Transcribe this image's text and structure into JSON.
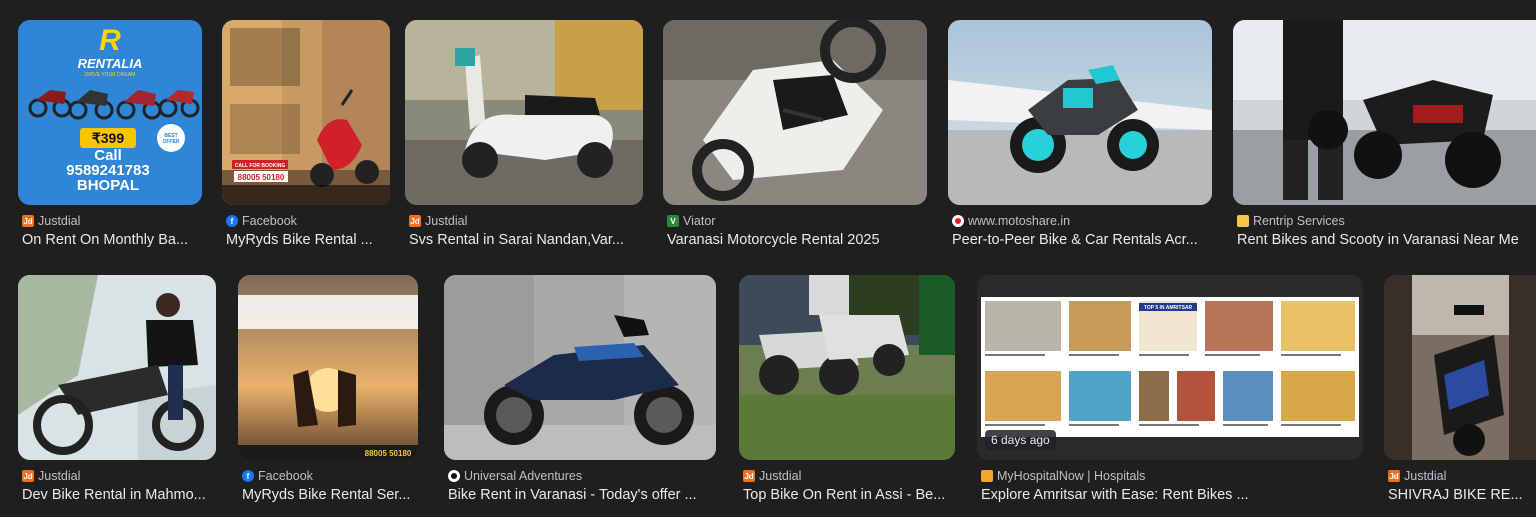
{
  "results": [
    {
      "source": "Justdial",
      "title": "On Rent On Monthly Ba...",
      "favicon": "justdial-icon",
      "overlay": {
        "brand": "RENTALIA",
        "tagline": "DRIVE YOUR DREAM",
        "price": "₹399",
        "offer": "BEST OFFER",
        "call": "Call",
        "phone": "9589241783",
        "city": "BHOPAL"
      }
    },
    {
      "source": "Facebook",
      "title": "MyRyds Bike Rental ...",
      "favicon": "facebook-icon",
      "overlay": {
        "cta": "CALL FOR BOOKING",
        "phone": "88005 50180"
      }
    },
    {
      "source": "Justdial",
      "title": "Svs Rental in Sarai Nandan,Var...",
      "favicon": "justdial-icon"
    },
    {
      "source": "Viator",
      "title": "Varanasi Motorcycle Rental 2025",
      "favicon": "viator-icon"
    },
    {
      "source": "www.motoshare.in",
      "title": "Peer-to-Peer Bike & Car Rentals Acr...",
      "favicon": "motoshare-icon"
    },
    {
      "source": "Rentrip Services",
      "title": "Rent Bikes and Scooty in Varanasi Near Me",
      "favicon": "rentrip-icon"
    },
    {
      "source": "Justdial",
      "title": "Dev Bike Rental in Mahmo...",
      "favicon": "justdial-icon"
    },
    {
      "source": "Facebook",
      "title": "MyRyds Bike Rental Ser...",
      "favicon": "facebook-icon",
      "overlay": {
        "phone": "88005 50180"
      }
    },
    {
      "source": "Universal Adventures",
      "title": "Bike Rent in Varanasi - Today's offer ...",
      "favicon": "universal-adventures-icon"
    },
    {
      "source": "Justdial",
      "title": "Top Bike On Rent in Assi - Be...",
      "favicon": "justdial-icon"
    },
    {
      "source": "MyHospitalNow | Hospitals",
      "title": "Explore Amritsar with Ease: Rent Bikes ...",
      "favicon": "myhospitalnow-icon",
      "badge": "6 days ago",
      "overlay": {
        "heading": "TOP 5 IN AMRITSAR"
      }
    },
    {
      "source": "Justdial",
      "title": "SHIVRAJ BIKE RE...",
      "favicon": "justdial-icon"
    }
  ],
  "colors": {
    "background": "#1f1f1f",
    "title": "#e8eaed",
    "source": "#bdc1c6",
    "justdial": "#f37021",
    "facebook": "#1877f2",
    "viator": "#2e8540"
  }
}
